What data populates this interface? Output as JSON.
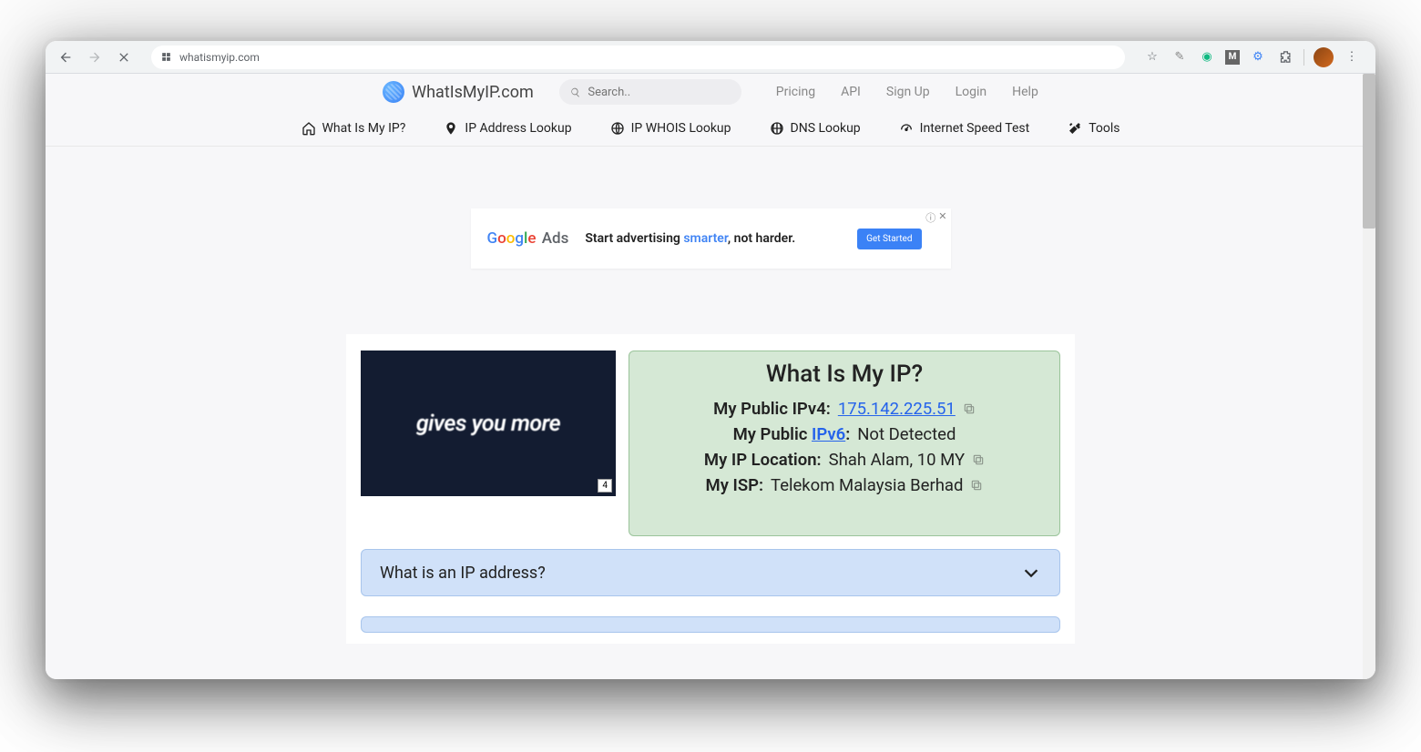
{
  "browser": {
    "url": "whatismyip.com"
  },
  "header": {
    "brand": "WhatIsMyIP.com",
    "search_placeholder": "Search..",
    "links": [
      "Pricing",
      "API",
      "Sign Up",
      "Login",
      "Help"
    ]
  },
  "nav": {
    "items": [
      {
        "label": "What Is My IP?",
        "icon": "home-icon"
      },
      {
        "label": "IP Address Lookup",
        "icon": "pin-icon"
      },
      {
        "label": "IP WHOIS Lookup",
        "icon": "globe-icon"
      },
      {
        "label": "DNS Lookup",
        "icon": "grid-globe-icon"
      },
      {
        "label": "Internet Speed Test",
        "icon": "speed-icon"
      },
      {
        "label": "Tools",
        "icon": "tools-icon"
      }
    ]
  },
  "ad": {
    "google": "Google",
    "ads_suffix": " Ads",
    "text_prefix": "Start advertising ",
    "text_highlight": "smarter",
    "text_suffix": ", not harder.",
    "button": "Get Started",
    "info": "ⓘ",
    "close": "✕"
  },
  "video_ad": {
    "text": "gives you more",
    "time": "4"
  },
  "ip_panel": {
    "title": "What Is My IP?",
    "rows": [
      {
        "label_prefix": "My Public IPv4:",
        "label_link": "",
        "value": "175.142.225.51",
        "value_is_link": true,
        "copy": true
      },
      {
        "label_prefix": "My Public ",
        "label_link": "IPv6",
        "label_suffix": ":",
        "value": "Not Detected",
        "value_is_link": false,
        "copy": false
      },
      {
        "label_prefix": "My IP Location:",
        "label_link": "",
        "value": "Shah Alam, 10 MY",
        "value_is_link": false,
        "copy": true
      },
      {
        "label_prefix": "My ISP:",
        "label_link": "",
        "value": "Telekom Malaysia Berhad",
        "value_is_link": false,
        "copy": true
      }
    ]
  },
  "accordion": {
    "items": [
      "What is an IP address?"
    ]
  }
}
